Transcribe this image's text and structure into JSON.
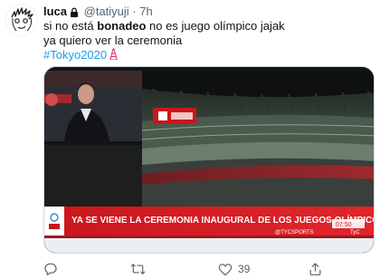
{
  "tweet": {
    "author_name": "luca",
    "author_handle": "@tatiyuji",
    "separator": "·",
    "time": "7h",
    "text_line1_before": "si no está ",
    "text_line1_bold": "bonadeo",
    "text_line1_after": " no es juego olímpico jajak",
    "text_line2": "ya quiero ver la ceremonia",
    "hashtag": "#Tokyo2020"
  },
  "media": {
    "tv_banner": "YA SE VIENE LA CEREMONIA INAUGURAL DE LOS JUEGOS OLÍMPICOS",
    "tv_handle": "@TYCSPORTS",
    "tv_clock": "07:50",
    "tv_channel": "TyC"
  },
  "actions": {
    "like_count": "39"
  },
  "colors": {
    "link": "#1d9bf0",
    "text": "#0f1419",
    "secondary": "#536471",
    "banner_red": "#d61a1f"
  },
  "icons": {
    "avatar": "doodle-avatar",
    "lock": "lock-icon",
    "hashtag_emoji": "tokyo-tower-icon",
    "reply": "reply-icon",
    "retweet": "retweet-icon",
    "like": "heart-icon",
    "share": "share-icon"
  }
}
